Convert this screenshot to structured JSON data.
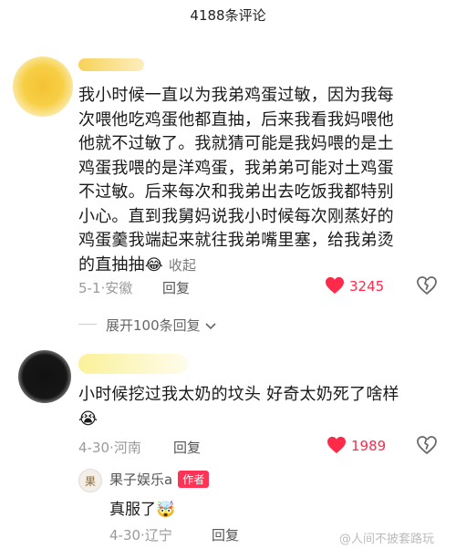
{
  "header": {
    "title": "4188条评论"
  },
  "comments": [
    {
      "lines": [
        "我小时候一直以为我弟鸡蛋过敏，因为我每",
        "次喂他吃鸡蛋他都直抽，后来我看我妈喂他",
        "他就不过敏了。我就猜可能是我妈喂的是土",
        "鸡蛋我喂的是洋鸡蛋，我弟弟可能对土鸡蛋",
        "不过敏。后来每次和我弟出去吃饭我都特别",
        "小心。直到我舅妈说我小时候每次刚蒸好的",
        "鸡蛋羹我端起来就往我弟嘴里塞，给我弟烫",
        "的直抽抽"
      ],
      "emoji": "😂",
      "collapse": "收起",
      "date": "5-1",
      "location": "安徽",
      "reply": "回复",
      "likes": "3245",
      "expand": "展开100条回复"
    },
    {
      "text": "小时候挖过我太奶的坟头 好奇太奶死了啥样",
      "emoji": "😭",
      "date": "4-30",
      "location": "河南",
      "reply": "回复",
      "likes": "1989"
    }
  ],
  "author_reply": {
    "name": "果子娱乐a",
    "badge": "作者",
    "avatar_glyph": "果",
    "text": "真服了",
    "emoji": "🤯",
    "date": "4-30",
    "location": "辽宁",
    "reply": "回复"
  },
  "watermark": "@人间不披套路玩",
  "colors": {
    "like": "#ff2a4a",
    "badge": "#ff3355"
  }
}
